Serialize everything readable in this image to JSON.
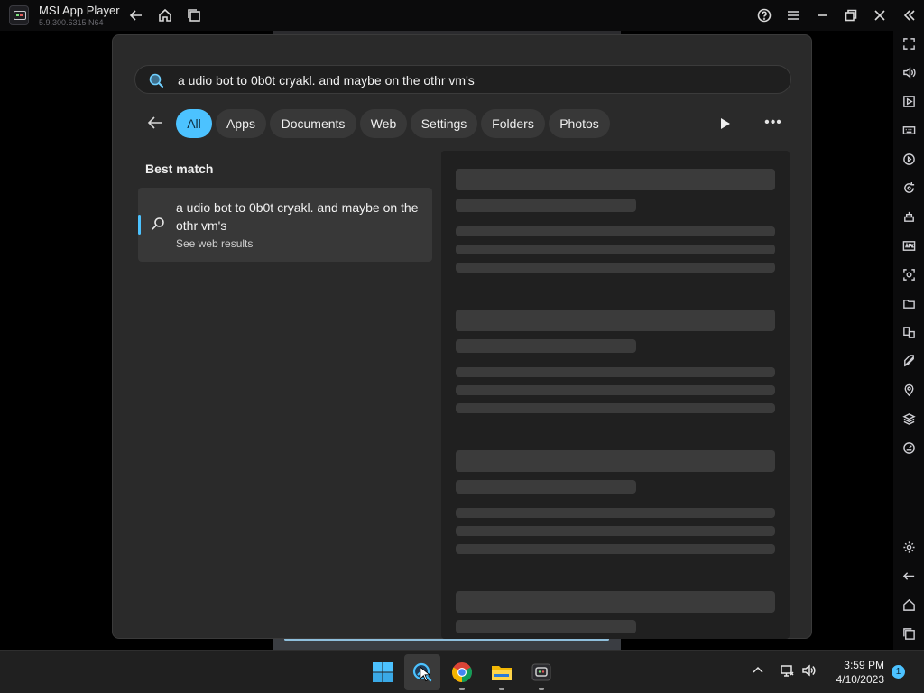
{
  "emulator": {
    "title": "MSI App Player",
    "version": "5.9.300.6315 N64"
  },
  "search": {
    "query": "a udio bot to 0b0t cryakl. and maybe on the othr vm's"
  },
  "filters": {
    "chips": [
      "All",
      "Apps",
      "Documents",
      "Web",
      "Settings",
      "Folders",
      "Photos"
    ],
    "active": "All",
    "more_label": "•••"
  },
  "results": {
    "best_match_label": "Best match",
    "best_match": {
      "title": "a udio bot to 0b0t cryakl. and maybe on the othr vm's",
      "subtitle": "See web results"
    }
  },
  "taskbar": {
    "time": "3:59 PM",
    "date": "4/10/2023",
    "notification_count": "1"
  },
  "colors": {
    "accent": "#4cc2ff",
    "panel": "#2a2a2a",
    "preview": "#202020",
    "skeleton": "#3b3b3b"
  },
  "icons": {
    "titlebar": [
      "back-icon",
      "home-icon",
      "multi-window-icon",
      "help-icon",
      "menu-icon",
      "minimize-icon",
      "restore-icon",
      "close-icon",
      "collapse-sidebar-icon"
    ],
    "toolstrip": [
      "fullscreen-icon",
      "volume-icon",
      "media-icon",
      "keyboard-icon",
      "macro-icon",
      "rotate-icon",
      "controller-icon",
      "apk-icon",
      "screenshot-icon",
      "folder-icon",
      "multi-instance-icon",
      "eco-mode-icon",
      "location-icon",
      "layers-icon",
      "performance-icon",
      "settings-icon",
      "android-back-icon",
      "android-home-icon",
      "recent-apps-icon"
    ]
  }
}
